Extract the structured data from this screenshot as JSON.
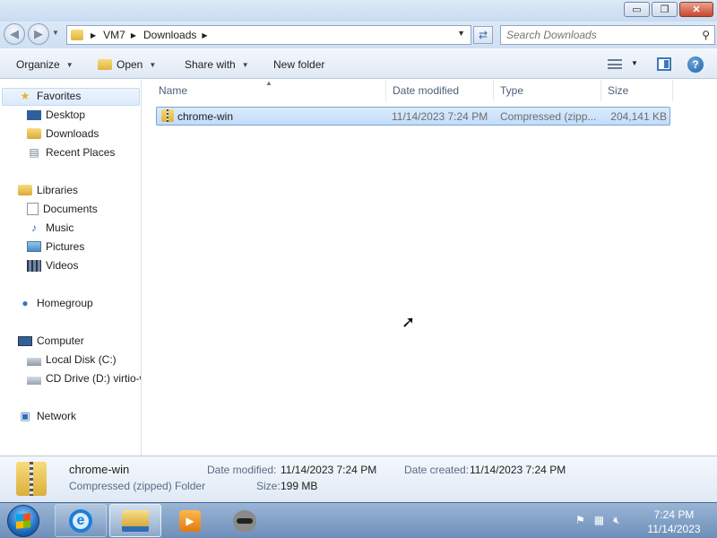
{
  "window": {
    "minimize": "▭",
    "maximize": "❐",
    "close": "✕"
  },
  "address": {
    "crumbs": [
      "VM7",
      "Downloads"
    ]
  },
  "search": {
    "placeholder": "Search Downloads"
  },
  "toolbar": {
    "organize": "Organize",
    "open": "Open",
    "share_with": "Share with",
    "new_folder": "New folder"
  },
  "nav": {
    "favorites": "Favorites",
    "desktop": "Desktop",
    "downloads": "Downloads",
    "recent_places": "Recent Places",
    "libraries": "Libraries",
    "documents": "Documents",
    "music": "Music",
    "pictures": "Pictures",
    "videos": "Videos",
    "homegroup": "Homegroup",
    "computer": "Computer",
    "local_disk": "Local Disk (C:)",
    "cd_drive": "CD Drive (D:) virtio-w",
    "network": "Network"
  },
  "columns": {
    "name": "Name",
    "date_modified": "Date modified",
    "type": "Type",
    "size": "Size"
  },
  "files": [
    {
      "name": "chrome-win",
      "date": "11/14/2023 7:24 PM",
      "type": "Compressed (zipp...",
      "size": "204,141 KB"
    }
  ],
  "details": {
    "name": "chrome-win",
    "type": "Compressed (zipped) Folder",
    "date_modified_label": "Date modified:",
    "date_modified": "11/14/2023 7:24 PM",
    "size_label": "Size:",
    "size": "199 MB",
    "date_created_label": "Date created:",
    "date_created": "11/14/2023 7:24 PM"
  },
  "taskbar": {
    "time": "7:24 PM",
    "date": "11/14/2023"
  }
}
